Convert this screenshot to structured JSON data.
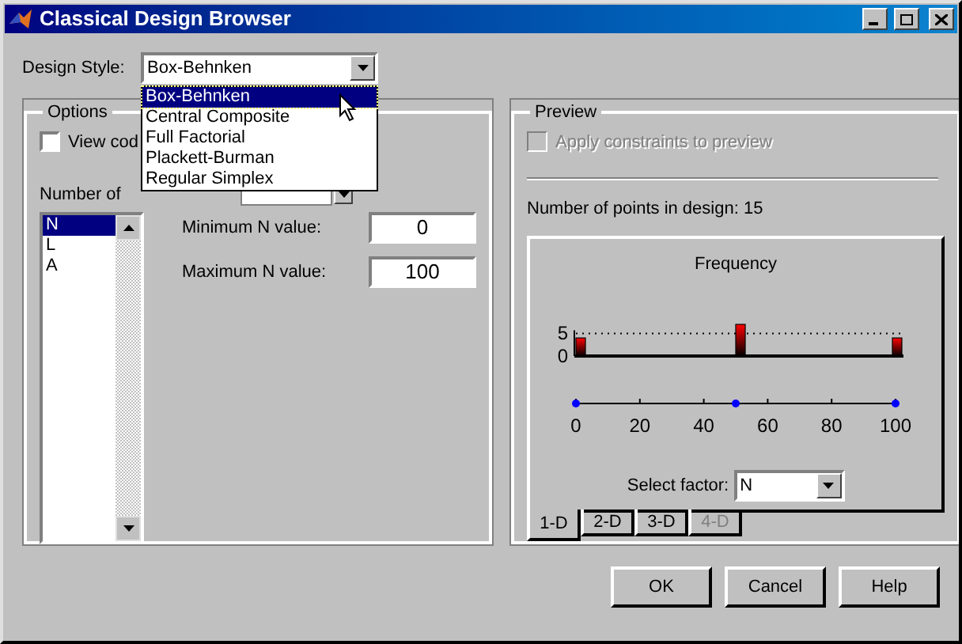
{
  "window": {
    "title": "Classical Design Browser"
  },
  "design_style": {
    "label": "Design Style:",
    "value": "Box-Behnken",
    "open": true,
    "options": [
      {
        "label": "Box-Behnken",
        "selected": true
      },
      {
        "label": "Central Composite",
        "selected": false
      },
      {
        "label": "Full Factorial",
        "selected": false
      },
      {
        "label": "Plackett-Burman",
        "selected": false
      },
      {
        "label": "Regular Simplex",
        "selected": false
      }
    ]
  },
  "options": {
    "title": "Options",
    "view_code": {
      "label": "View cod",
      "checked": false
    },
    "center_points": {
      "label": "Number of"
    },
    "factors": [
      {
        "label": "N",
        "selected": true
      },
      {
        "label": "L",
        "selected": false
      },
      {
        "label": "A",
        "selected": false
      }
    ],
    "min": {
      "label": "Minimum N value:",
      "value": "0"
    },
    "max": {
      "label": "Maximum N value:",
      "value": "100"
    }
  },
  "preview": {
    "title": "Preview",
    "apply_constraints": {
      "label": "Apply constraints to preview",
      "checked": false,
      "disabled": true
    },
    "points": "Number of points in design: 15",
    "chart_data": {
      "type": "bar",
      "title": "Frequency",
      "x": [
        0,
        50,
        100
      ],
      "values": [
        4,
        7,
        4
      ],
      "xlim": [
        0,
        100
      ],
      "ylim": [
        0,
        7
      ],
      "xticks": [
        0,
        20,
        40,
        60,
        80,
        100
      ],
      "yticks": [
        0,
        5
      ]
    },
    "select_factor": {
      "label": "Select factor:",
      "value": "N"
    },
    "tabs": [
      {
        "label": "1-D",
        "selected": true,
        "disabled": false
      },
      {
        "label": "2-D",
        "selected": false,
        "disabled": false
      },
      {
        "label": "3-D",
        "selected": false,
        "disabled": false
      },
      {
        "label": "4-D",
        "selected": false,
        "disabled": true
      }
    ]
  },
  "buttons": [
    "OK",
    "Cancel",
    "Help"
  ]
}
